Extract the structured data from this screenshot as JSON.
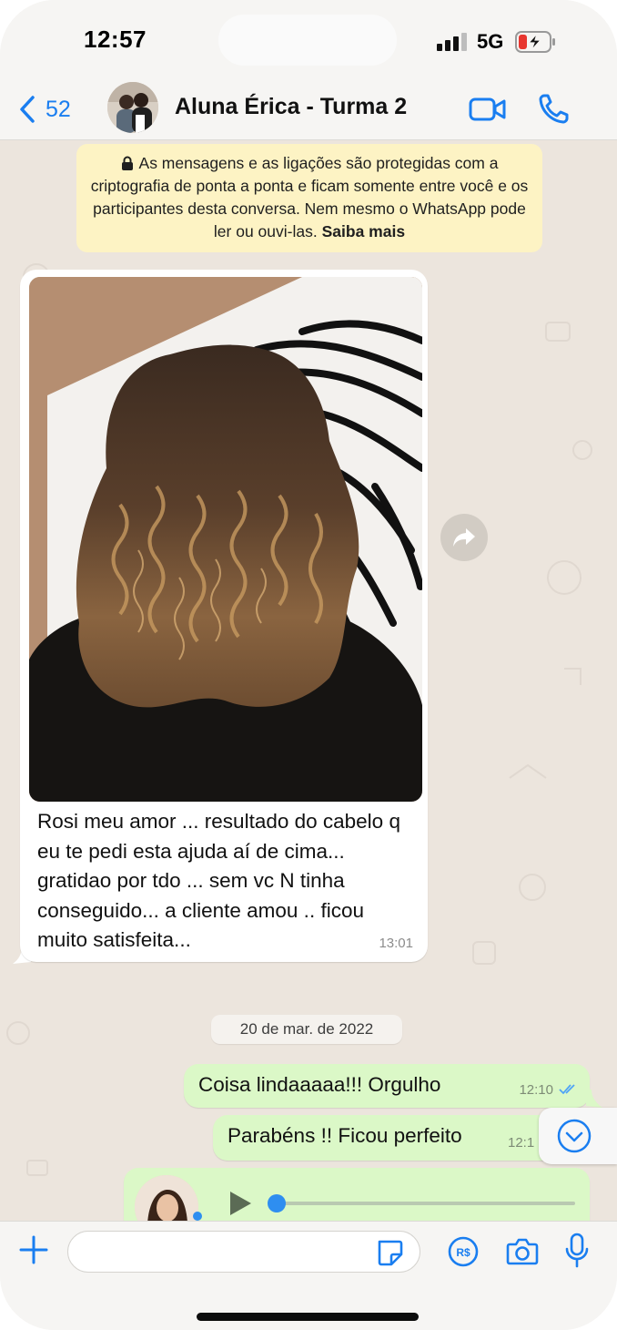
{
  "status_bar": {
    "time": "12:57",
    "network": "5G"
  },
  "header": {
    "back_count": "52",
    "contact_name": "Aluna Érica - Turma 2"
  },
  "encryption_notice": {
    "text": "As mensagens e as ligações são protegidas com a criptografia de ponta a ponta e ficam somente entre você e os participantes desta conversa. Nem mesmo o WhatsApp pode ler ou ouvi-las.",
    "learn_more": "Saiba mais"
  },
  "messages": {
    "incoming_photo": {
      "caption": "Rosi meu amor ... resultado do cabelo q eu te pedi esta ajuda aí de cima... gratidao  por tdo ... sem vc N tinha  conseguido... a cliente amou .. ficou muito satisfeita...",
      "time": "13:01"
    },
    "date_separator": "20 de mar. de 2022",
    "outgoing": [
      {
        "text": "Coisa lindaaaaa!!! Orgulho",
        "time": "12:10",
        "status": "read"
      },
      {
        "text": "Parabéns !! Ficou perfeito",
        "time": "12:1"
      }
    ],
    "audio": {
      "progress": 0.0
    }
  },
  "input": {
    "placeholder": ""
  },
  "colors": {
    "accent": "#1a7ef0",
    "outgoing_bubble": "#dbf8c7",
    "incoming_bubble": "#ffffff",
    "notice_bg": "#fdf3c4",
    "chat_bg": "#ece5dd",
    "read_ticks": "#4fa3f7"
  },
  "icons": {
    "back": "chevron-left-icon",
    "video_call": "video-camera-icon",
    "voice_call": "phone-icon",
    "lock": "lock-icon",
    "forward": "forward-icon",
    "scroll_down": "chevron-down-icon",
    "play": "play-icon",
    "attach": "plus-icon",
    "sticker": "sticker-icon",
    "payment": "pix-payment-icon",
    "camera": "camera-icon",
    "mic": "microphone-icon"
  }
}
